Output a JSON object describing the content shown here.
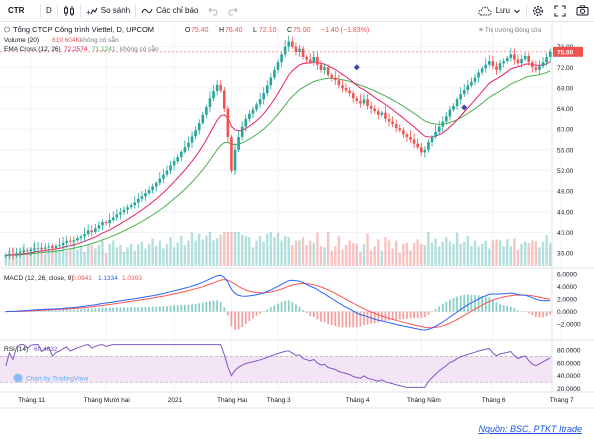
{
  "toolbar": {
    "symbol": "CTR",
    "interval": "D",
    "compare_label": "So sánh",
    "indicators_label": "Các chỉ báo",
    "save_label": "Lưu"
  },
  "legend": {
    "title": "Tổng CTCP Công trình Viettel, D, UPCOM",
    "open_label": "O",
    "open": "75.40",
    "high_label": "H",
    "high": "76.40",
    "low_label": "L",
    "low": "72.10",
    "close_label": "C",
    "close": "75.00",
    "change": "−1.40 (−1.83%)",
    "volume_label": "Volume (20)",
    "volume_value": "619.604K",
    "volume_na": "không có sẵn",
    "ema_label": "EMA Cross (12, 26)",
    "ema_fast": "72.2574",
    "ema_slow": "71.1241",
    "ema_na": "không có sẵn",
    "market_status": "Thị trường Đóng cửa",
    "macd_label": "MACD (12, 26, close, 9)",
    "macd_hist": "0.0941",
    "macd_line": "1.1334",
    "macd_signal": "1.0393",
    "rsi_label": "RSI (14)",
    "rsi_value": "60.4832",
    "watermark": "Chart by TradingView"
  },
  "colors": {
    "up": "#26a69a",
    "down": "#ef5350",
    "ema_fast": "#e91e63",
    "ema_slow": "#4caf50",
    "macd_line": "#2962ff",
    "macd_signal": "#ff5252",
    "rsi_line": "#7e57c2",
    "rsi_band": "#f3e5f5",
    "price_tag": "#ef5350",
    "marker": "#3949ab"
  },
  "source_note": "Nguồn: BSC, PTKT Itrade",
  "chart_data": {
    "type": "candlestick",
    "price_axis": {
      "ticks": [
        36.0,
        40.0,
        44.0,
        48.0,
        52.0,
        56.0,
        60.0,
        64.0,
        68.0,
        72.0,
        76.0
      ],
      "range": [
        33.5,
        80
      ],
      "last_price_label": "75.00"
    },
    "macd_axis": {
      "ticks": [
        "6.0000",
        "4.0000",
        "2.0000",
        "0.0000",
        "−2.0000"
      ],
      "tick_values": [
        6,
        4,
        2,
        0,
        -2
      ],
      "range": [
        -4.2,
        6.6
      ]
    },
    "rsi_axis": {
      "ticks": [
        "80.0000",
        "60.0000",
        "40.0000",
        "20.0000"
      ],
      "tick_values": [
        80,
        60,
        40,
        20
      ],
      "range": [
        18,
        92
      ],
      "band": [
        30,
        70
      ]
    },
    "time_axis": [
      {
        "label": "Tháng 11",
        "index": 7
      },
      {
        "label": "Tháng Mười hai",
        "index": 28
      },
      {
        "label": "2021",
        "index": 47
      },
      {
        "label": "Tháng Hai",
        "index": 63
      },
      {
        "label": "Tháng 3",
        "index": 76
      },
      {
        "label": "Tháng 4",
        "index": 98
      },
      {
        "label": "Tháng Năm",
        "index": 116
      },
      {
        "label": "Tháng 6",
        "index": 136
      },
      {
        "label": "Tháng 7",
        "index": 155
      }
    ],
    "close_series": [
      35.6,
      35.8,
      35.7,
      36.0,
      36.2,
      36.5,
      36.4,
      36.7,
      36.9,
      37.0,
      36.8,
      37.1,
      37.3,
      37.0,
      37.4,
      37.6,
      38.0,
      38.4,
      38.2,
      38.5,
      38.9,
      39.2,
      39.7,
      40.4,
      40.1,
      40.8,
      41.4,
      42.0,
      41.8,
      42.4,
      42.9,
      43.5,
      43.9,
      44.4,
      44.9,
      45.3,
      45.8,
      46.5,
      47.0,
      47.6,
      48.2,
      48.9,
      49.6,
      50.4,
      51.2,
      52.0,
      53.0,
      53.8,
      54.6,
      55.6,
      56.5,
      57.4,
      58.6,
      59.8,
      61.2,
      62.8,
      64.3,
      66.0,
      67.4,
      68.6,
      67.5,
      64.0,
      58.5,
      52.0,
      56.0,
      58.5,
      60.5,
      62.0,
      63.0,
      63.8,
      64.8,
      65.8,
      67.0,
      68.5,
      70.0,
      71.5,
      73.0,
      74.5,
      76.0,
      77.0,
      76.0,
      75.0,
      75.6,
      74.0,
      73.5,
      73.0,
      74.0,
      72.5,
      71.5,
      72.0,
      70.5,
      70.0,
      69.5,
      68.5,
      68.0,
      67.5,
      67.0,
      66.0,
      65.5,
      65.0,
      65.8,
      64.5,
      64.0,
      63.5,
      62.8,
      63.2,
      62.0,
      61.5,
      61.0,
      60.2,
      59.8,
      59.0,
      58.5,
      58.0,
      57.2,
      56.5,
      55.5,
      56.0,
      57.5,
      58.5,
      59.5,
      60.5,
      61.5,
      62.5,
      63.8,
      64.5,
      65.8,
      66.8,
      67.6,
      68.5,
      69.2,
      70.0,
      71.0,
      71.8,
      72.5,
      73.2,
      72.2,
      71.5,
      72.8,
      73.2,
      73.8,
      74.5,
      73.5,
      72.8,
      73.6,
      74.2,
      73.0,
      72.0,
      71.5,
      72.2,
      73.0,
      74.0,
      75.0
    ],
    "markers": [
      {
        "type": "up-arrow",
        "index": 98,
        "price": 72.0
      },
      {
        "type": "down-arrow",
        "index": 128,
        "price": 64.2
      }
    ]
  }
}
